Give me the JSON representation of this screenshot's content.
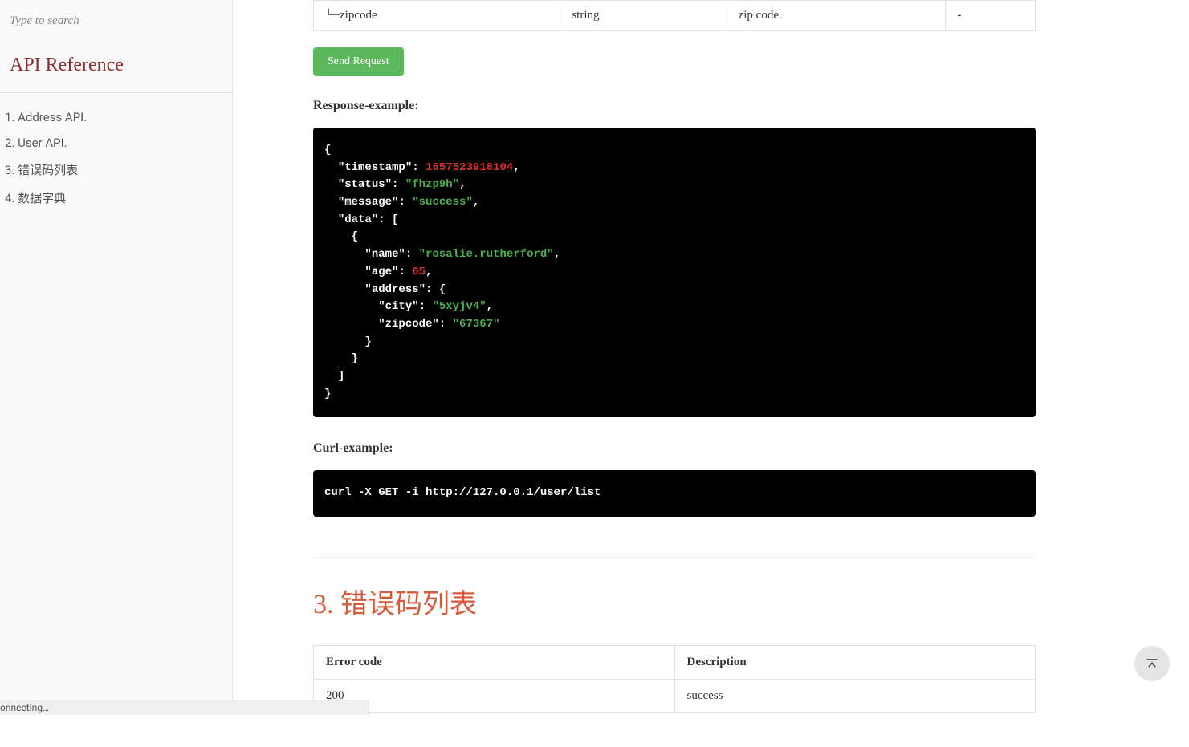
{
  "sidebar": {
    "search_placeholder": "Type to search",
    "title": "API Reference",
    "items": [
      "1. Address API.",
      "2. User API.",
      "3. 错误码列表",
      "4. 数据字典"
    ]
  },
  "params_row": {
    "field_prefix": "└─",
    "field": "zipcode",
    "type": "string",
    "desc": "zip code.",
    "since": "-"
  },
  "buttons": {
    "send_request": "Send Request"
  },
  "labels": {
    "response_example": "Response-example:",
    "curl_example": "Curl-example:"
  },
  "response_json": {
    "tokens": [
      {
        "t": "punc",
        "v": "{"
      },
      {
        "t": "indent",
        "v": "  "
      },
      {
        "t": "key",
        "v": "\"timestamp\""
      },
      {
        "t": "punc",
        "v": ": "
      },
      {
        "t": "num",
        "v": "1657523918104"
      },
      {
        "t": "punc",
        "v": ","
      },
      {
        "t": "nl"
      },
      {
        "t": "indent",
        "v": "  "
      },
      {
        "t": "key",
        "v": "\"status\""
      },
      {
        "t": "punc",
        "v": ": "
      },
      {
        "t": "str",
        "v": "\"fhzp9h\""
      },
      {
        "t": "punc",
        "v": ","
      },
      {
        "t": "nl"
      },
      {
        "t": "indent",
        "v": "  "
      },
      {
        "t": "key",
        "v": "\"message\""
      },
      {
        "t": "punc",
        "v": ": "
      },
      {
        "t": "str",
        "v": "\"success\""
      },
      {
        "t": "punc",
        "v": ","
      },
      {
        "t": "nl"
      },
      {
        "t": "indent",
        "v": "  "
      },
      {
        "t": "key",
        "v": "\"data\""
      },
      {
        "t": "punc",
        "v": ": ["
      },
      {
        "t": "nl"
      },
      {
        "t": "indent",
        "v": "    "
      },
      {
        "t": "punc",
        "v": "{"
      },
      {
        "t": "nl"
      },
      {
        "t": "indent",
        "v": "      "
      },
      {
        "t": "key",
        "v": "\"name\""
      },
      {
        "t": "punc",
        "v": ": "
      },
      {
        "t": "str",
        "v": "\"rosalie.rutherford\""
      },
      {
        "t": "punc",
        "v": ","
      },
      {
        "t": "nl"
      },
      {
        "t": "indent",
        "v": "      "
      },
      {
        "t": "key",
        "v": "\"age\""
      },
      {
        "t": "punc",
        "v": ": "
      },
      {
        "t": "num",
        "v": "65"
      },
      {
        "t": "punc",
        "v": ","
      },
      {
        "t": "nl"
      },
      {
        "t": "indent",
        "v": "      "
      },
      {
        "t": "key",
        "v": "\"address\""
      },
      {
        "t": "punc",
        "v": ": {"
      },
      {
        "t": "nl"
      },
      {
        "t": "indent",
        "v": "        "
      },
      {
        "t": "key",
        "v": "\"city\""
      },
      {
        "t": "punc",
        "v": ": "
      },
      {
        "t": "str",
        "v": "\"5xyjv4\""
      },
      {
        "t": "punc",
        "v": ","
      },
      {
        "t": "nl"
      },
      {
        "t": "indent",
        "v": "        "
      },
      {
        "t": "key",
        "v": "\"zipcode\""
      },
      {
        "t": "punc",
        "v": ": "
      },
      {
        "t": "str",
        "v": "\"67367\""
      },
      {
        "t": "nl"
      },
      {
        "t": "indent",
        "v": "      "
      },
      {
        "t": "punc",
        "v": "}"
      },
      {
        "t": "nl"
      },
      {
        "t": "indent",
        "v": "    "
      },
      {
        "t": "punc",
        "v": "}"
      },
      {
        "t": "nl"
      },
      {
        "t": "indent",
        "v": "  "
      },
      {
        "t": "punc",
        "v": "]"
      },
      {
        "t": "nl"
      },
      {
        "t": "punc",
        "v": "}"
      }
    ]
  },
  "curl_command": "curl -X GET -i http://127.0.0.1/user/list",
  "section3": {
    "heading": "3. 错误码列表",
    "table": {
      "headers": [
        "Error code",
        "Description"
      ],
      "rows": [
        [
          "200",
          "success"
        ]
      ]
    }
  },
  "status_bar": "onnecting…"
}
